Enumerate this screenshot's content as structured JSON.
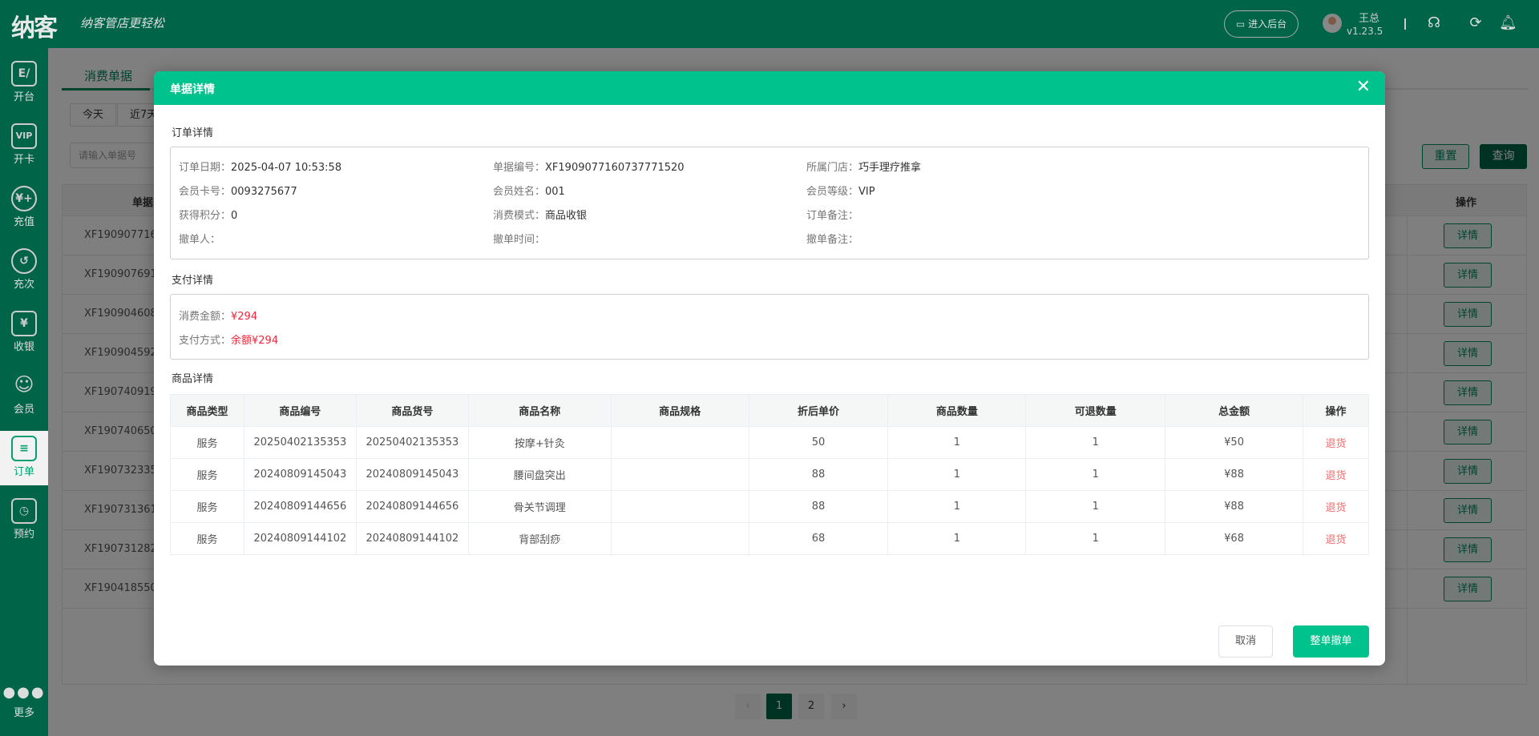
{
  "header": {
    "logo": "纳客",
    "slogan": "纳客管店更轻松",
    "backend_button": "进入后台",
    "user_name": "王总",
    "version": "v1.23.5"
  },
  "sidebar": {
    "items": [
      {
        "label": "开台",
        "icon": "E/"
      },
      {
        "label": "开卡",
        "icon": "VIP"
      },
      {
        "label": "充值",
        "icon": "¥+"
      },
      {
        "label": "充次",
        "icon": "↺"
      },
      {
        "label": "收银",
        "icon": "¥"
      },
      {
        "label": "会员",
        "icon": "☺"
      },
      {
        "label": "订单",
        "icon": "≡"
      },
      {
        "label": "预约",
        "icon": "◷"
      }
    ],
    "more": "更多"
  },
  "background": {
    "tab_active": "消费单据",
    "filters": [
      "今天",
      "近7天"
    ],
    "search_placeholder": "请输入单据号",
    "reset": "重置",
    "query": "查询",
    "col_no": "单据",
    "col_op": "操作",
    "rows": [
      "XF190907716",
      "XF190907691",
      "XF190904608",
      "XF190904592",
      "XF190740919",
      "XF190740650",
      "XF190732335",
      "XF190731361",
      "XF190731282",
      "XF190418550"
    ],
    "detail_btn": "详情",
    "pagination": {
      "prev": "‹",
      "pages": [
        "1",
        "2"
      ],
      "next": "›",
      "current": "1"
    }
  },
  "modal": {
    "title": "单据详情",
    "order_section": "订单详情",
    "order_fields": [
      {
        "k": "订单日期：",
        "v": "2025-04-07 10:53:58"
      },
      {
        "k": "单据编号：",
        "v": "XF1909077160737771520"
      },
      {
        "k": "所属门店：",
        "v": "巧手理疗推拿"
      },
      {
        "k": "会员卡号：",
        "v": "0093275677"
      },
      {
        "k": "会员姓名：",
        "v": "001"
      },
      {
        "k": "会员等级：",
        "v": "VIP"
      },
      {
        "k": "获得积分：",
        "v": "0"
      },
      {
        "k": "消费模式：",
        "v": "商品收银"
      },
      {
        "k": "订单备注：",
        "v": ""
      },
      {
        "k": "撤单人：",
        "v": ""
      },
      {
        "k": "撤单时间：",
        "v": ""
      },
      {
        "k": "撤单备注：",
        "v": ""
      }
    ],
    "pay_section": "支付详情",
    "pay_fields": [
      {
        "k": "消费金额：",
        "v": "¥294"
      },
      {
        "k": "支付方式：",
        "v": "余额¥294"
      }
    ],
    "goods_section": "商品详情",
    "goods_headers": [
      "商品类型",
      "商品编号",
      "商品货号",
      "商品名称",
      "商品规格",
      "折后单价",
      "商品数量",
      "可退数量",
      "总金额",
      "操作"
    ],
    "goods_rows": [
      [
        "服务",
        "20250402135353",
        "20250402135353",
        "按摩+针灸",
        "",
        "50",
        "1",
        "1",
        "¥50"
      ],
      [
        "服务",
        "20240809145043",
        "20240809145043",
        "腰间盘突出",
        "",
        "88",
        "1",
        "1",
        "¥88"
      ],
      [
        "服务",
        "20240809144656",
        "20240809144656",
        "骨关节调理",
        "",
        "88",
        "1",
        "1",
        "¥88"
      ],
      [
        "服务",
        "20240809144102",
        "20240809144102",
        "背部刮痧",
        "",
        "68",
        "1",
        "1",
        "¥68"
      ]
    ],
    "return_label": "退货",
    "cancel": "取消",
    "revoke": "整单撤单",
    "colors": {
      "accent": "#00c28c",
      "brand": "#006548",
      "danger": "#f0283c"
    }
  }
}
